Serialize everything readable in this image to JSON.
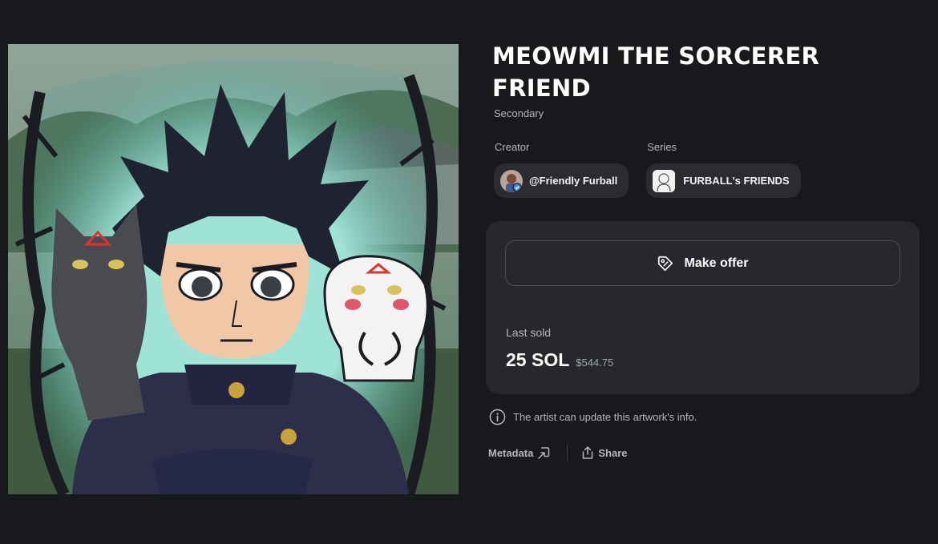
{
  "artwork": {
    "title": "MEOWMI THE SORCERER FRIEND",
    "edition": "Secondary"
  },
  "creator": {
    "label": "Creator",
    "name": "@Friendly Furball",
    "avatar_icon": "creator-avatar"
  },
  "series": {
    "label": "Series",
    "name": "FURBALL's FRIENDS",
    "thumb_icon": "series-thumbnail"
  },
  "offer": {
    "button_label": "Make offer",
    "button_icon": "tag-icon"
  },
  "sale": {
    "label": "Last sold",
    "price": "25 SOL",
    "usd": "$544.75"
  },
  "notice": {
    "icon": "info-icon",
    "text": "The artist can update this artwork's info."
  },
  "links": {
    "metadata": "Metadata",
    "share": "Share"
  },
  "colors": {
    "background": "#18191c",
    "panel": "#26282c",
    "chip": "#2a2c31",
    "text_primary": "#ffffff",
    "text_secondary": "#b4b6bb"
  }
}
